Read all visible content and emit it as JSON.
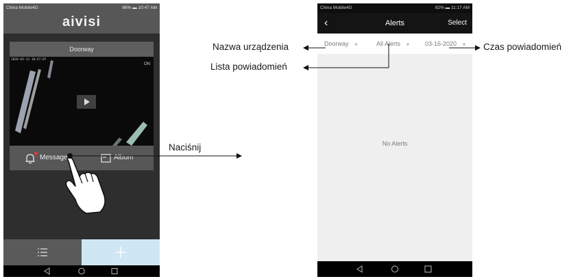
{
  "left_phone": {
    "status_bar": {
      "carrier": "China Mobile4G",
      "battery": "86%",
      "time": "10:47 AM"
    },
    "app_title": "aivisi",
    "device_name": "Doorway",
    "video": {
      "timestamp": "2020-03-13 10:47:07",
      "status": "ON",
      "play_icon": "play-icon"
    },
    "actions": {
      "message_label": "Message",
      "album_label": "Album"
    },
    "bottom_tabs": {
      "list_icon": "list-icon",
      "add_icon": "plus-icon"
    },
    "accent_colors": {
      "add_tab_bg": "#cfe7f3",
      "notification_dot": "#e53935"
    }
  },
  "right_phone": {
    "status_bar": {
      "carrier": "China Mobile4G",
      "battery": "82%",
      "time": "11:17 AM"
    },
    "header": {
      "back_icon": "chevron-left-icon",
      "title": "Alerts",
      "select_label": "Select"
    },
    "filters": {
      "device": "Doorway",
      "alert_type": "All Alerts",
      "date": "03-16-2020"
    },
    "empty_message": "No Alerts"
  },
  "annotations": {
    "device_name_label": "Nazwa urządzenia",
    "alert_list_label": "Lista powiadomień",
    "alert_time_label": "Czas powiadomień",
    "press_label": "Naciśnij"
  }
}
